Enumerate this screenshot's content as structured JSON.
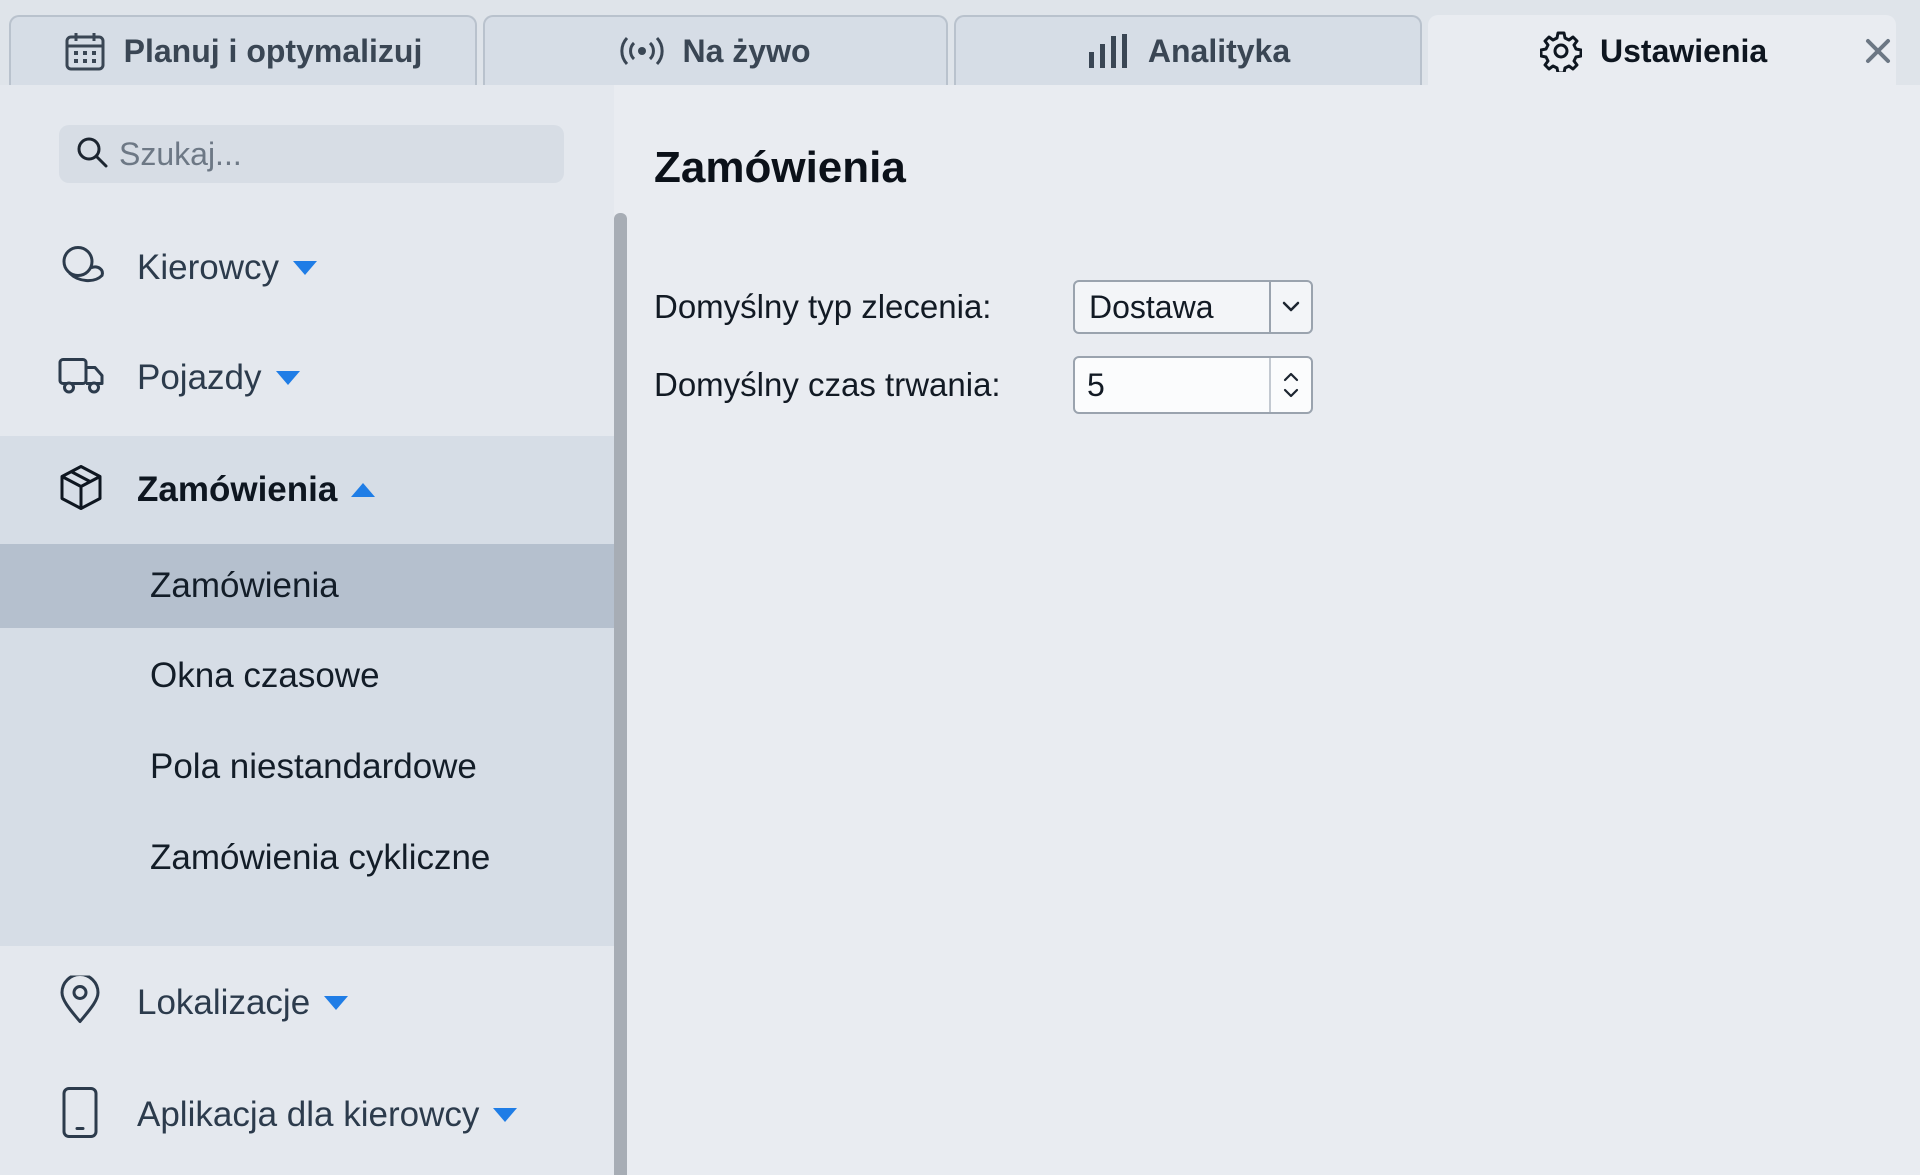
{
  "tabs": [
    {
      "label": "Planuj i optymalizuj",
      "icon": "calendar-icon"
    },
    {
      "label": "Na żywo",
      "icon": "broadcast-icon"
    },
    {
      "label": "Analityka",
      "icon": "bar-chart-icon"
    },
    {
      "label": "Ustawienia",
      "icon": "gear-icon",
      "active": true
    }
  ],
  "search": {
    "placeholder": "Szukaj..."
  },
  "sidebar": {
    "items": [
      {
        "label": "Kierowcy",
        "icon": "drivers-icon",
        "expanded": false
      },
      {
        "label": "Pojazdy",
        "icon": "truck-icon",
        "expanded": false
      },
      {
        "label": "Zamówienia",
        "icon": "package-icon",
        "expanded": true
      },
      {
        "label": "Lokalizacje",
        "icon": "map-pin-icon",
        "expanded": false
      },
      {
        "label": "Aplikacja dla kierowcy",
        "icon": "phone-icon",
        "expanded": false
      }
    ],
    "sub_items": [
      {
        "label": "Zamówienia",
        "selected": true
      },
      {
        "label": "Okna czasowe"
      },
      {
        "label": "Pola niestandardowe"
      },
      {
        "label": "Zamówienia cykliczne"
      }
    ]
  },
  "main": {
    "title": "Zamówienia",
    "order_type": {
      "label": "Domyślny typ zlecenia:",
      "value": "Dostawa"
    },
    "duration": {
      "label": "Domyślny czas trwania:",
      "value": "5"
    }
  },
  "colors": {
    "accent": "#1f7de6",
    "selected_row": "#b5c0ce"
  }
}
